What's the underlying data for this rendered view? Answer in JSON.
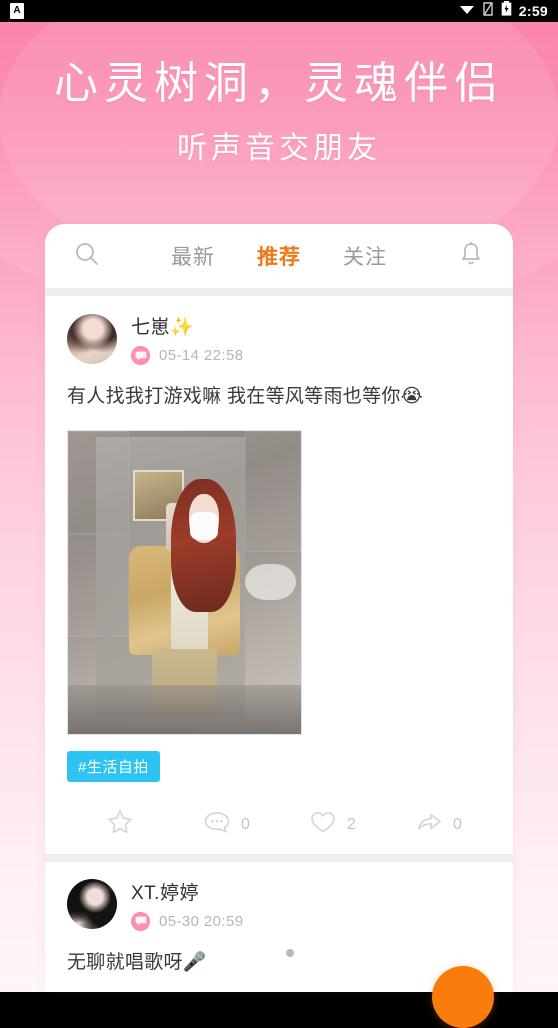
{
  "status_bar": {
    "app_badge": "A",
    "time": "2:59",
    "icons": [
      "wifi-icon",
      "signal-off-icon",
      "battery-charging-icon"
    ]
  },
  "banner": {
    "title": "心灵树洞，灵魂伴侣",
    "subtitle": "听声音交朋友",
    "text_color": "#ffffff",
    "background_color": "#fb7aa4"
  },
  "tabbar": {
    "search_icon": "search-icon",
    "bell_icon": "bell-icon",
    "tabs": [
      {
        "label": "最新",
        "active": false
      },
      {
        "label": "推荐",
        "active": true
      },
      {
        "label": "关注",
        "active": false
      }
    ],
    "active_color": "#f07818",
    "inactive_color": "#9a9a9a"
  },
  "posts": [
    {
      "username": "七崽✨",
      "timestamp": "05-14 22:58",
      "badge_icon": "chat-bubble-badge-icon",
      "text": "有人找我打游戏嘛 我在等风等雨也等你😭",
      "image": "mirror-selfie-photo",
      "tag": "#生活自拍",
      "tag_color": "#2ec4f1",
      "actions": [
        {
          "icon": "star-icon",
          "count": ""
        },
        {
          "icon": "comment-icon",
          "count": "0"
        },
        {
          "icon": "heart-icon",
          "count": "2"
        },
        {
          "icon": "share-icon",
          "count": "0"
        }
      ]
    },
    {
      "username": "XT.婷婷",
      "timestamp": "05-30 20:59",
      "badge_icon": "chat-bubble-badge-icon",
      "text": "无聊就唱歌呀🎤"
    }
  ],
  "fab": {
    "name": "compose-button",
    "color": "#f97c0c"
  }
}
